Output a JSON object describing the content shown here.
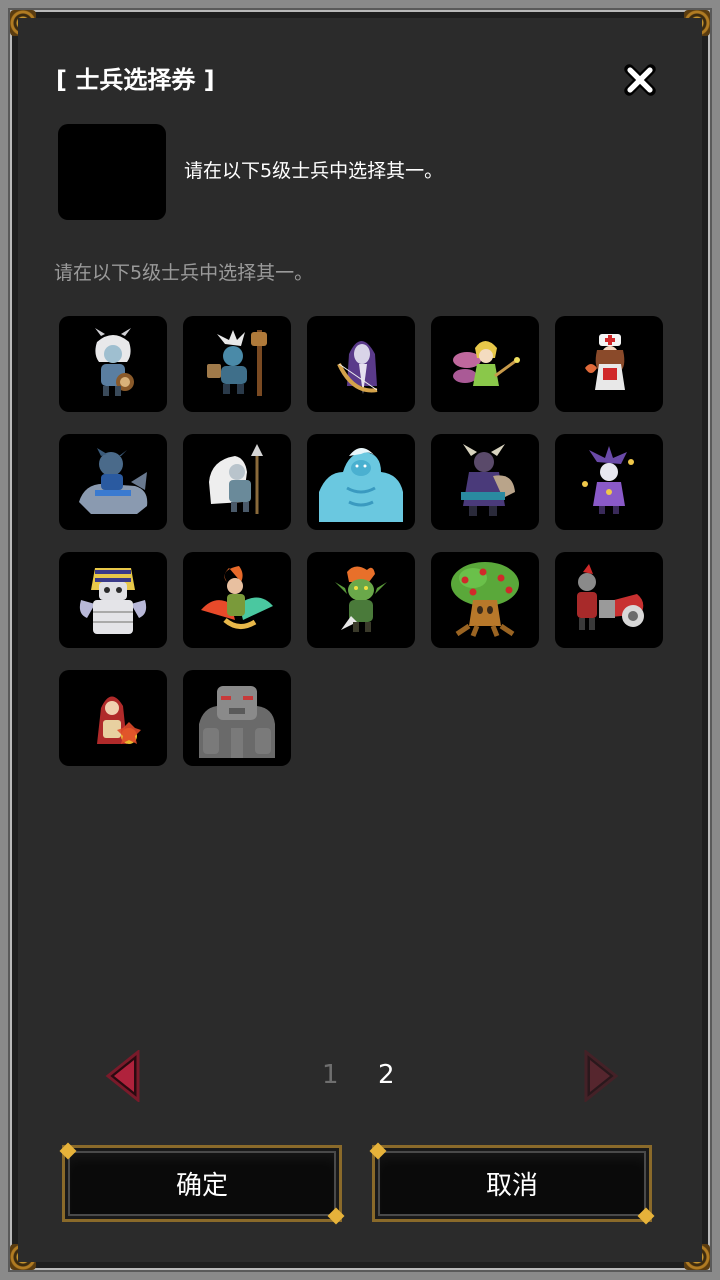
{
  "dialog": {
    "title": "[ 士兵选择券 ]",
    "item_description": "请在以下5级士兵中选择其一。",
    "hint": "请在以下5级士兵中选择其一。"
  },
  "units": [
    {
      "icon": "white-haired-drummer-icon"
    },
    {
      "icon": "totem-shaman-icon"
    },
    {
      "icon": "hooded-archer-icon"
    },
    {
      "icon": "fairy-icon"
    },
    {
      "icon": "nurse-healer-icon"
    },
    {
      "icon": "wolf-rider-icon"
    },
    {
      "icon": "white-mane-spearman-icon"
    },
    {
      "icon": "ice-troll-icon"
    },
    {
      "icon": "horned-knight-icon"
    },
    {
      "icon": "jester-mage-icon"
    },
    {
      "icon": "pharaoh-mummy-icon"
    },
    {
      "icon": "phoenix-rider-icon"
    },
    {
      "icon": "goblin-warrior-icon"
    },
    {
      "icon": "apple-treant-icon"
    },
    {
      "icon": "cannon-knight-icon"
    },
    {
      "icon": "red-hood-mage-icon"
    },
    {
      "icon": "stone-golem-icon"
    }
  ],
  "pager": {
    "pages": [
      "1",
      "2"
    ],
    "current": "2"
  },
  "buttons": {
    "confirm": "确定",
    "cancel": "取消"
  },
  "colors": {
    "panel": "#2b2b2b",
    "frame": "#8a8a8a",
    "gold": "#c4932e",
    "arrow": "#b0223c"
  }
}
